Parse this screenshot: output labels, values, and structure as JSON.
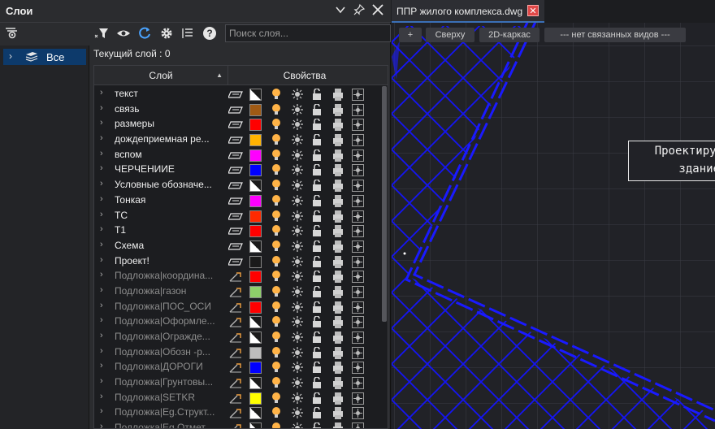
{
  "panel": {
    "title": "Слои",
    "search_placeholder": "Поиск слоя...",
    "tree_item": "Все",
    "current_layer_label": "Текущий слой : 0",
    "col_layer": "Слой",
    "col_props": "Свойства"
  },
  "layers": [
    {
      "name": "текст",
      "color": "#ffffff",
      "linetype": "continuous",
      "xref": false
    },
    {
      "name": "связь",
      "color": "#a05a14",
      "linetype": "continuous",
      "xref": false
    },
    {
      "name": "размеры",
      "color": "#ff0000",
      "linetype": "continuous",
      "xref": false
    },
    {
      "name": "дождеприемная ре...",
      "color": "#ffb300",
      "linetype": "continuous",
      "xref": false
    },
    {
      "name": "вспом",
      "color": "#ff00ff",
      "linetype": "continuous",
      "xref": false
    },
    {
      "name": "ЧЕРЧЕНИИЕ",
      "color": "#0000ff",
      "linetype": "continuous",
      "xref": false
    },
    {
      "name": "Условные обозначе...",
      "color": "#ffffff",
      "linetype": "continuous",
      "xref": false
    },
    {
      "name": "Тонкая",
      "color": "#ff00ff",
      "linetype": "continuous",
      "xref": false
    },
    {
      "name": "ТС",
      "color": "#ff2a00",
      "linetype": "continuous",
      "xref": false
    },
    {
      "name": "Т1",
      "color": "#ff0000",
      "linetype": "continuous",
      "xref": false
    },
    {
      "name": "Схема",
      "color": "#ffffff",
      "linetype": "continuous",
      "xref": false
    },
    {
      "name": "Проект!",
      "color": "#1a1a1a",
      "linetype": "continuous",
      "xref": false
    },
    {
      "name": "Подложка|координа...",
      "color": "#ff0000",
      "linetype": "xref",
      "xref": true
    },
    {
      "name": "Подложка|газон",
      "color": "#8ed06a",
      "linetype": "xref",
      "xref": true
    },
    {
      "name": "Подложка|ПОС_ОСИ",
      "color": "#ff0000",
      "linetype": "xref",
      "xref": true
    },
    {
      "name": "Подложка|Оформле...",
      "color": "#ffffff",
      "linetype": "xref",
      "xref": true
    },
    {
      "name": "Подложка|Огражде...",
      "color": "#ffffff",
      "linetype": "xref",
      "xref": true
    },
    {
      "name": "Подложка|Обозн -р...",
      "color": "#bdbdbd",
      "linetype": "xref",
      "xref": true
    },
    {
      "name": "Подложка|ДОРОГИ",
      "color": "#0000ff",
      "linetype": "xref",
      "xref": true
    },
    {
      "name": "Подложка|Грунтовы...",
      "color": "#ffffff",
      "linetype": "xref",
      "xref": true
    },
    {
      "name": "Подложка|SETKR",
      "color": "#ffff00",
      "linetype": "xref",
      "xref": true
    },
    {
      "name": "Подложка|Eg.Структ...",
      "color": "#ffffff",
      "linetype": "xref",
      "xref": true
    },
    {
      "name": "Подложка|Eg.Отмет...",
      "color": "#ffffff",
      "linetype": "xref",
      "xref": true
    }
  ],
  "drawing": {
    "tab_title": "ППР жилого комплекса.dwg",
    "view_buttons": [
      "+",
      "Сверху",
      "2D-каркас",
      "--- нет связанных видов ---"
    ],
    "annotation_lines": [
      "Проектируе",
      "здание"
    ]
  },
  "colors": {
    "accent": "#0d3a6b",
    "drawing_lines": "#1414ff",
    "tab_close": "#e04848"
  }
}
